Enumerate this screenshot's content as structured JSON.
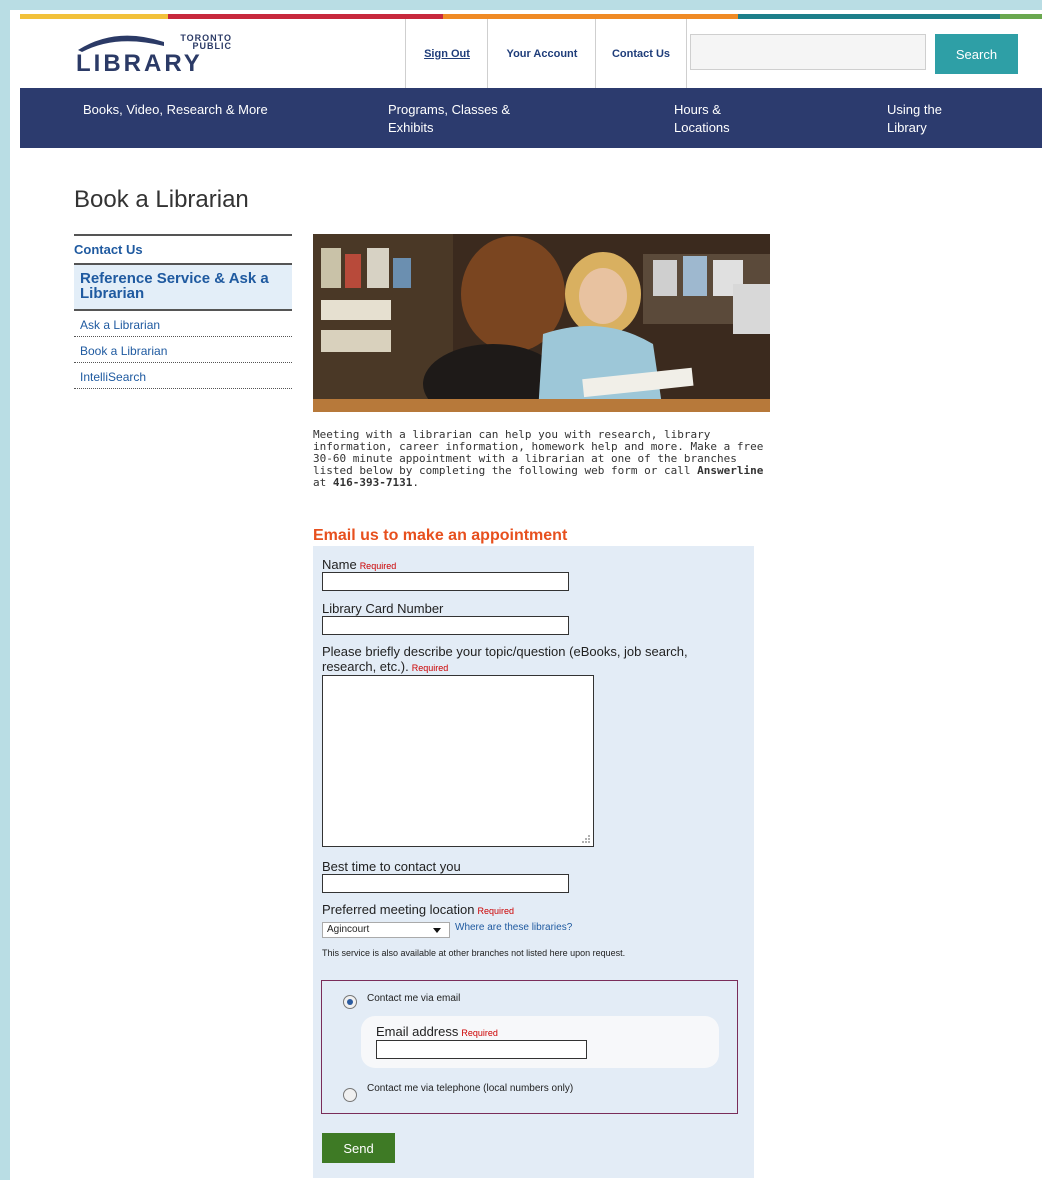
{
  "header": {
    "logo_small": "TORONTO PUBLIC",
    "logo_big": "LIBRARY",
    "links": [
      "Sign Out",
      "Your Account",
      "Contact Us"
    ],
    "search_placeholder": "",
    "search_button": "Search",
    "stripe_colors": [
      "#f2c13a",
      "#c8283c",
      "#f08a24",
      "#1d7f8a",
      "#6aa84f"
    ]
  },
  "nav": {
    "items": [
      "Books, Video, Research & More",
      "Programs, Classes & Exhibits",
      "Hours & Locations",
      "Using the Library"
    ]
  },
  "page": {
    "title": "Book a Librarian"
  },
  "sidebar": {
    "top": "Contact Us",
    "section": "Reference Service & Ask a Librarian",
    "items": [
      "Ask a Librarian",
      "Book a Librarian",
      "IntelliSearch"
    ]
  },
  "intro": {
    "text": "Meeting with a librarian can help you with research, library information, career information, homework help and more. Make a free 30-60 minute appointment with a librarian at one of the branches listed below by completing the following web form or call",
    "answerline": "Answerline",
    "at": "at",
    "phone": "416-393-7131",
    "period": "."
  },
  "form": {
    "title": "Email us to make an appointment",
    "name_label": "Name",
    "required": "Required",
    "card_label": "Library Card Number",
    "topic_label": "Please briefly describe your topic/question (eBooks, job search, research, etc.).",
    "time_label": "Best time to contact you",
    "location_label": "Preferred meeting location",
    "location_value": "Agincourt",
    "location_link": "Where are these libraries?",
    "note": "This service is also available at other branches not listed here upon request.",
    "contact_email": "Contact me via email",
    "email_label": "Email address",
    "contact_phone": "Contact me via telephone (local numbers only)",
    "send": "Send"
  }
}
